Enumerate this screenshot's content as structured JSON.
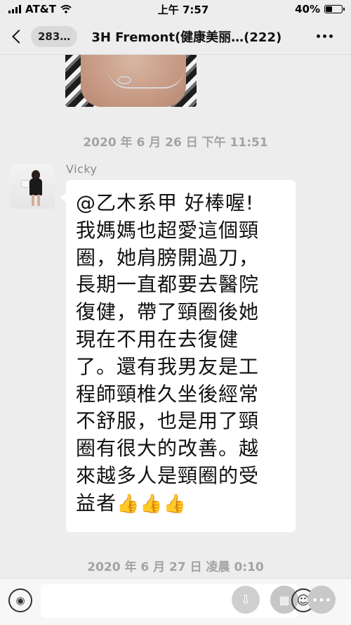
{
  "status_bar": {
    "carrier": "AT&T",
    "time": "上午 7:57",
    "battery": "40%",
    "battery_level": 0.4
  },
  "nav": {
    "unread_count": "283…",
    "title": "3H  Fremont(健康美丽…(222)"
  },
  "messages": {
    "timestamp_1": "2020 年 6 月 26 日  下午 11:51",
    "sender_name": "Vicky",
    "bubble_lines": [
      "@乙木系甲  好棒喔!",
      "我媽媽也超愛這個頸",
      "圈，她肩膀開過刀，",
      "長期一直都要去醫院",
      "復健，帶了頸圈後她",
      "現在不用在去復健",
      "了。還有我男友是工",
      "程師頸椎久坐後經常",
      "不舒服，也是用了頸",
      "圈有很大的改善。越",
      "來越多人是頸圈的受"
    ],
    "bubble_last_line": "益者",
    "thumbs": "👍👍👍",
    "timestamp_2": "2020 年 6 月 27 日  凌晨 0:10"
  },
  "icons": {
    "voice": "voice-icon",
    "emoji": "emoji-icon",
    "more": "more-icon"
  },
  "colors": {
    "background": "#ededed",
    "bubble": "#ffffff",
    "timestamp": "#a3a3a3"
  }
}
